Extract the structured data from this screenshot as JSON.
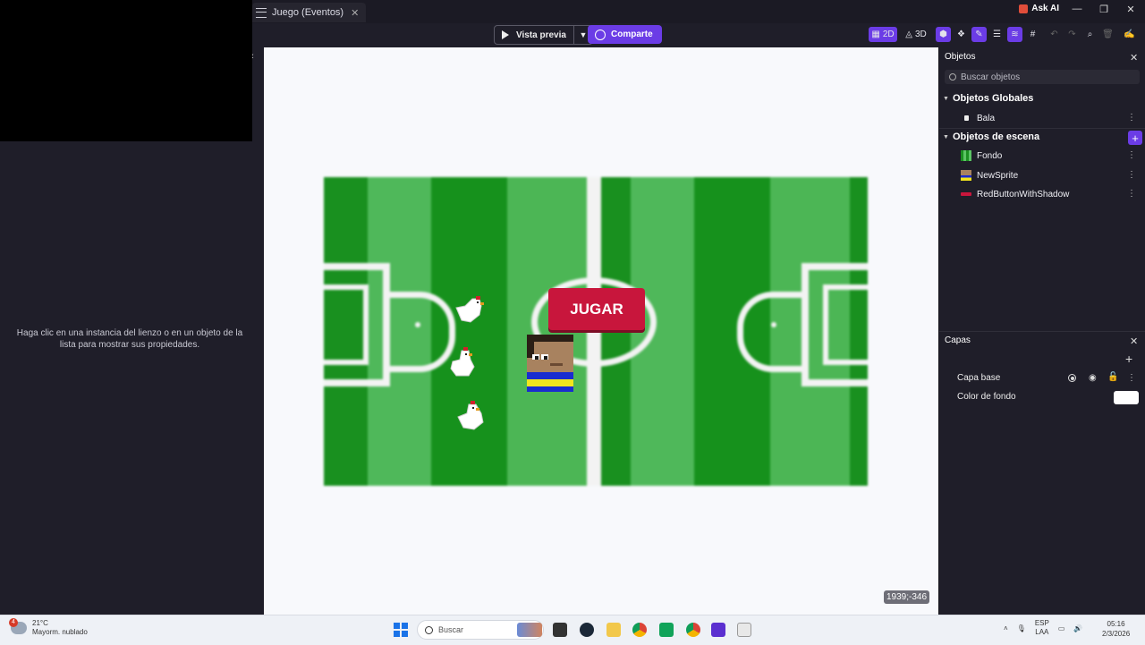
{
  "window": {
    "tab_title": "Juego (Eventos)",
    "ask_ai": "Ask AI"
  },
  "toolbar": {
    "preview_label": "Vista previa",
    "share_label": "Comparte",
    "mode_2d": "2D",
    "mode_3d": "3D",
    "accent": "#6b3ce6"
  },
  "left_panel": {
    "hint": "Haga clic en una instancia del lienzo o en un objeto de la lista para mostrar sus propiedades."
  },
  "canvas": {
    "button_label": "JUGAR",
    "coords": "1939;-346",
    "field_colors": [
      "#19901f",
      "#4fb85a"
    ]
  },
  "objects_panel": {
    "title": "Objetos",
    "search_placeholder": "Buscar objetos",
    "global_group": "Objetos Globales",
    "global_items": [
      {
        "label": "Bala",
        "icon": "bullet-thumb"
      }
    ],
    "scene_group": "Objetos de escena",
    "scene_items": [
      {
        "label": "Fondo",
        "icon": "field-thumb"
      },
      {
        "label": "NewSprite",
        "icon": "sprite-thumb"
      },
      {
        "label": "RedButtonWithShadow",
        "icon": "red-button-thumb"
      }
    ]
  },
  "layers_panel": {
    "title": "Capas",
    "base_layer": "Capa base",
    "bg_color_label": "Color de fondo",
    "bg_color": "#ffffff"
  },
  "taskbar": {
    "weather_temp": "21°C",
    "weather_desc": "Mayorm. nublado",
    "weather_badge": "4",
    "search_label": "Buscar",
    "lang_top": "ESP",
    "lang_bottom": "LAA",
    "time": "05:16",
    "date": "2/3/2026"
  }
}
